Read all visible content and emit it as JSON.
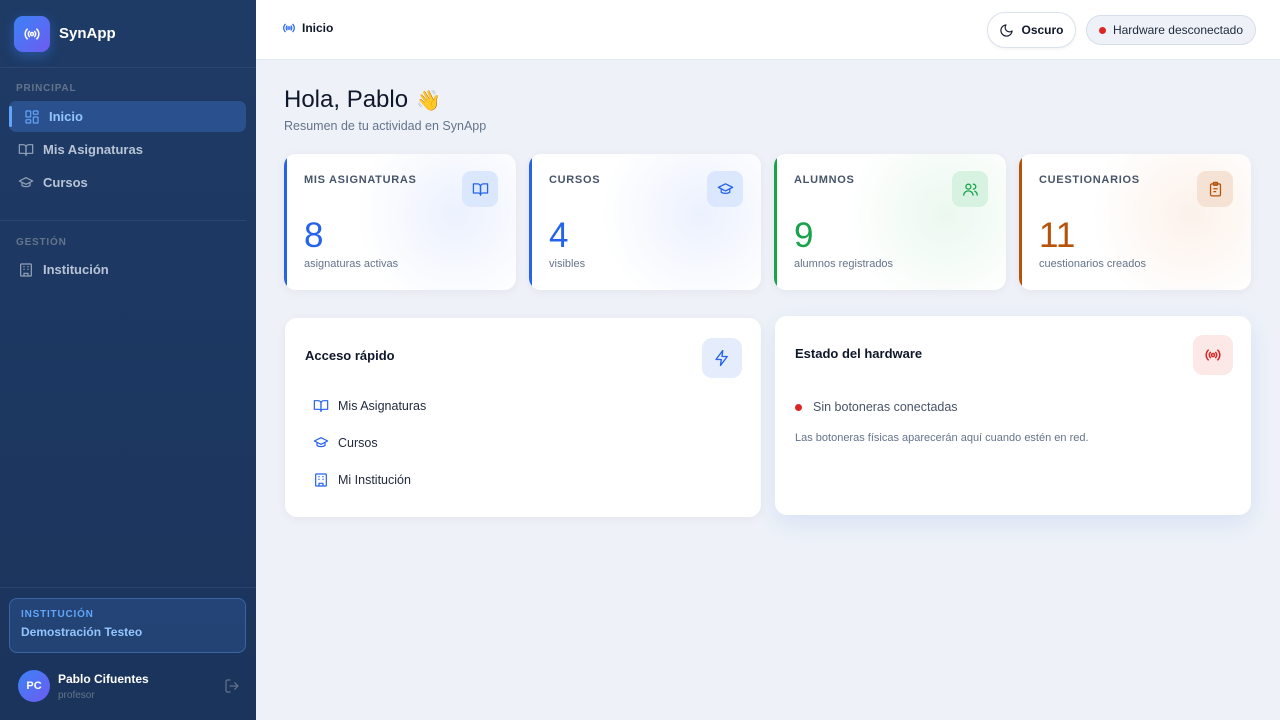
{
  "app": {
    "name": "SynApp"
  },
  "sidebar": {
    "sections": [
      {
        "title": "PRINCIPAL",
        "items": [
          {
            "label": "Inicio",
            "icon": "grid-icon",
            "active": true
          },
          {
            "label": "Mis Asignaturas",
            "icon": "book-icon"
          },
          {
            "label": "Cursos",
            "icon": "graduation-cap-icon"
          }
        ]
      },
      {
        "title": "GESTIÓN",
        "items": [
          {
            "label": "Institución",
            "icon": "building-icon"
          }
        ]
      }
    ],
    "institution": {
      "label": "INSTITUCIÓN",
      "name": "Demostración Testeo"
    },
    "user": {
      "initials": "PC",
      "name": "Pablo Cifuentes",
      "role": "profesor"
    }
  },
  "topbar": {
    "breadcrumb": "Inicio",
    "theme_button": "Oscuro",
    "hardware_badge": "Hardware desconectado"
  },
  "main": {
    "greeting": "Hola, Pablo",
    "greeting_emoji": "👋",
    "subtitle": "Resumen de tu actividad en SynApp",
    "stats": [
      {
        "label": "MIS ASIGNATURAS",
        "value": "8",
        "desc": "asignaturas activas",
        "color": "#2563eb",
        "icon": "book-icon"
      },
      {
        "label": "CURSOS",
        "value": "4",
        "desc": "visibles",
        "color": "#2563eb",
        "icon": "graduation-cap-icon"
      },
      {
        "label": "ALUMNOS",
        "value": "9",
        "desc": "alumnos registrados",
        "color": "#16a34a",
        "icon": "users-icon"
      },
      {
        "label": "CUESTIONARIOS",
        "value": "11",
        "desc": "cuestionarios creados",
        "color": "#b45309",
        "icon": "clipboard-icon"
      }
    ],
    "quick_access": {
      "title": "Acceso rápido",
      "links": [
        {
          "label": "Mis Asignaturas",
          "icon": "book-icon"
        },
        {
          "label": "Cursos",
          "icon": "graduation-cap-icon"
        },
        {
          "label": "Mi Institución",
          "icon": "building-icon"
        }
      ]
    },
    "hardware": {
      "title": "Estado del hardware",
      "status": "Sin botoneras conectadas",
      "note": "Las botoneras físicas aparecerán aquí cuando estén en red.",
      "status_color": "#dc2626"
    }
  }
}
